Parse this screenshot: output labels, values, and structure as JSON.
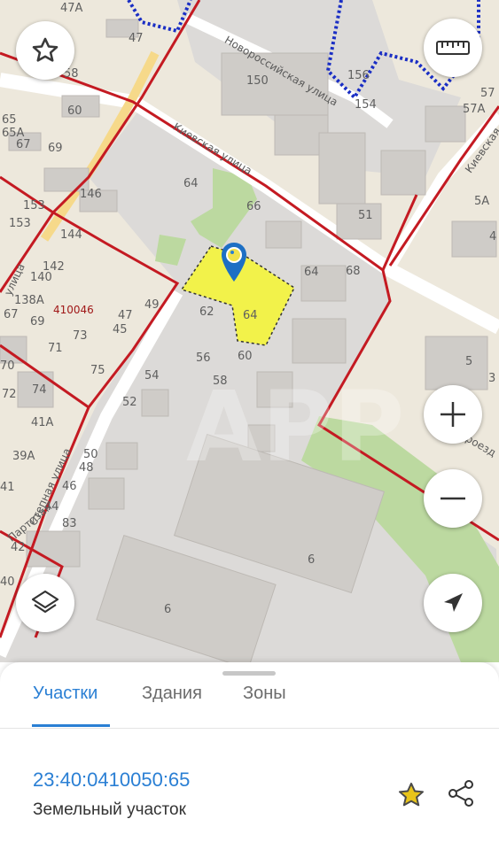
{
  "map": {
    "streets": [
      {
        "id": "novorossiyskaya",
        "label": "Новороссийская улица"
      },
      {
        "id": "kievskaya",
        "label": "Киевская улица"
      },
      {
        "id": "kievskaya-right",
        "label": "Киевская"
      },
      {
        "id": "stepnaya",
        "label": "Степная улица"
      },
      {
        "id": "ulitsa-left",
        "label": "улица"
      },
      {
        "id": "partizan",
        "label": "Партизан"
      },
      {
        "id": "proezd",
        "label": "роезд"
      }
    ],
    "house_numbers": [
      "47А",
      "47",
      "58",
      "60",
      "65А",
      "67",
      "69",
      "65",
      "146",
      "64",
      "66",
      "150",
      "154",
      "156",
      "57",
      "57А",
      "51",
      "5А",
      "4",
      "153",
      "153",
      "144",
      "142",
      "140",
      "138А",
      "67",
      "69",
      "71",
      "73",
      "47",
      "45",
      "49",
      "62",
      "64",
      "64",
      "68",
      "56",
      "60",
      "54",
      "58",
      "52",
      "70",
      "72",
      "74",
      "41А",
      "39А",
      "50",
      "48",
      "46",
      "44",
      "83",
      "42",
      "41",
      "40",
      "75",
      "5",
      "3",
      "6",
      "6",
      "52"
    ],
    "parcel_code": "410046",
    "watermark": "APP"
  },
  "controls": {
    "favorite": "star-icon",
    "ruler": "ruler-icon",
    "zoom_in": "plus-icon",
    "zoom_out": "minus-icon",
    "layers": "layers-icon",
    "locate": "navigation-arrow-icon"
  },
  "sheet": {
    "tabs": [
      {
        "label": "Участки",
        "active": true
      },
      {
        "label": "Здания",
        "active": false
      },
      {
        "label": "Зоны",
        "active": false
      }
    ],
    "cadastral_number": "23:40:0410050:65",
    "object_type": "Земельный участок",
    "accent_color": "#2a7fd4",
    "star_color": "#e8c41a"
  }
}
